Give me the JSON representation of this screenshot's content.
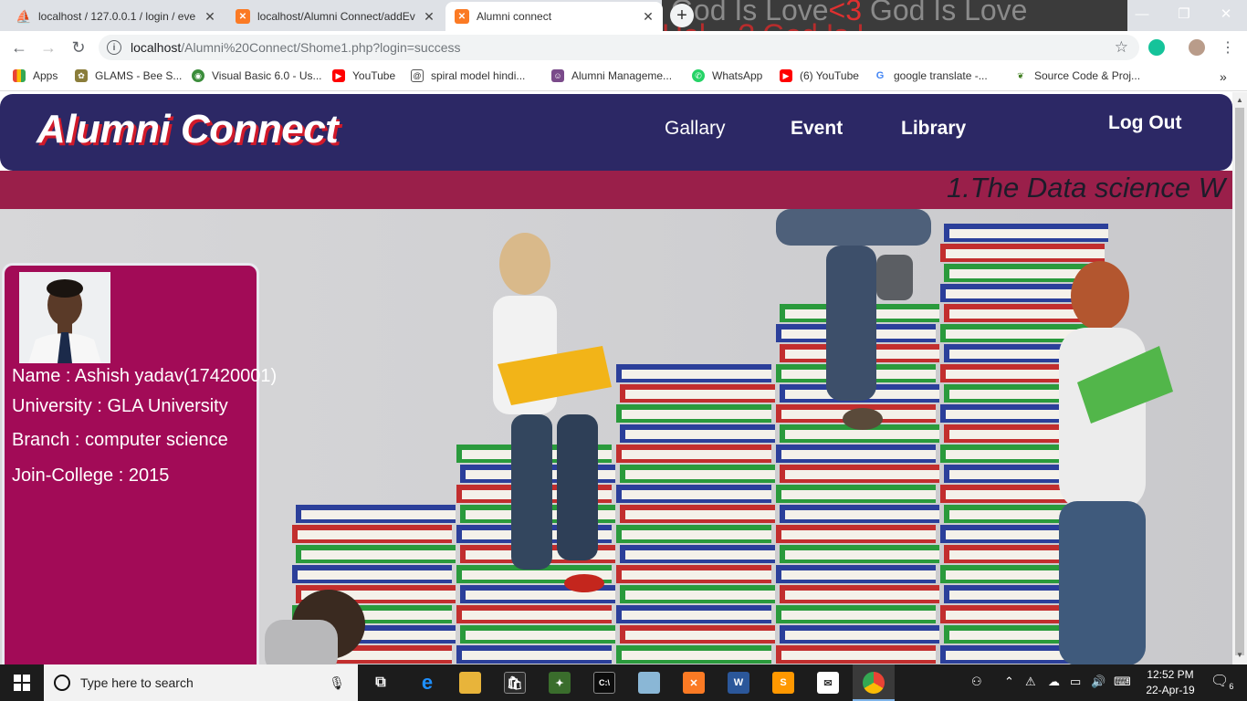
{
  "browser": {
    "tabs": [
      {
        "title": "localhost / 127.0.0.1 / login / eve",
        "icon": "phpmyadmin-icon",
        "active": false
      },
      {
        "title": "localhost/Alumni Connect/addEv",
        "icon": "xampp-icon",
        "active": false
      },
      {
        "title": "Alumni connect",
        "icon": "xampp-icon",
        "active": true
      }
    ],
    "wallpaper_text_1": "God Is Love",
    "wallpaper_text_1_heart": "<3",
    "wallpaper_text_1_tail": " God Is Love",
    "wallpaper_text_2": "Hel... ? God Is L...",
    "url_host": "localhost",
    "url_path": "/Alumni%20Connect/Shome1.php?login=success",
    "bookmarks": [
      {
        "label": "Apps",
        "icon": "apps-grid-icon"
      },
      {
        "label": "GLAMS - Bee S...",
        "icon": "bee-icon"
      },
      {
        "label": "Visual Basic 6.0 - Us...",
        "icon": "globe-icon"
      },
      {
        "label": "YouTube",
        "icon": "youtube-icon"
      },
      {
        "label": "spiral model hindi...",
        "icon": "spiral-icon"
      },
      {
        "label": "Alumni Manageme...",
        "icon": "person-icon"
      },
      {
        "label": "WhatsApp",
        "icon": "whatsapp-icon"
      },
      {
        "label": "(6) YouTube",
        "icon": "youtube-icon"
      },
      {
        "label": "google translate -...",
        "icon": "google-icon"
      },
      {
        "label": "Source Code & Proj...",
        "icon": "leaf-icon"
      }
    ],
    "more_bookmarks": "»"
  },
  "site": {
    "brand": "Alumni Connect",
    "nav": [
      {
        "label": "Gallary"
      },
      {
        "label": "Event"
      },
      {
        "label": "Library"
      },
      {
        "label": "Log Out"
      }
    ],
    "marquee": "1.The Data science W"
  },
  "profile": {
    "name": "Name : Ashish yadav(17420001)",
    "university": "University : GLA University",
    "branch": "Branch : computer science",
    "join": "Join-College : 2015"
  },
  "taskbar": {
    "search_placeholder": "Type here to search",
    "time": "12:52 PM",
    "date": "22-Apr-19",
    "notifications": "6"
  }
}
